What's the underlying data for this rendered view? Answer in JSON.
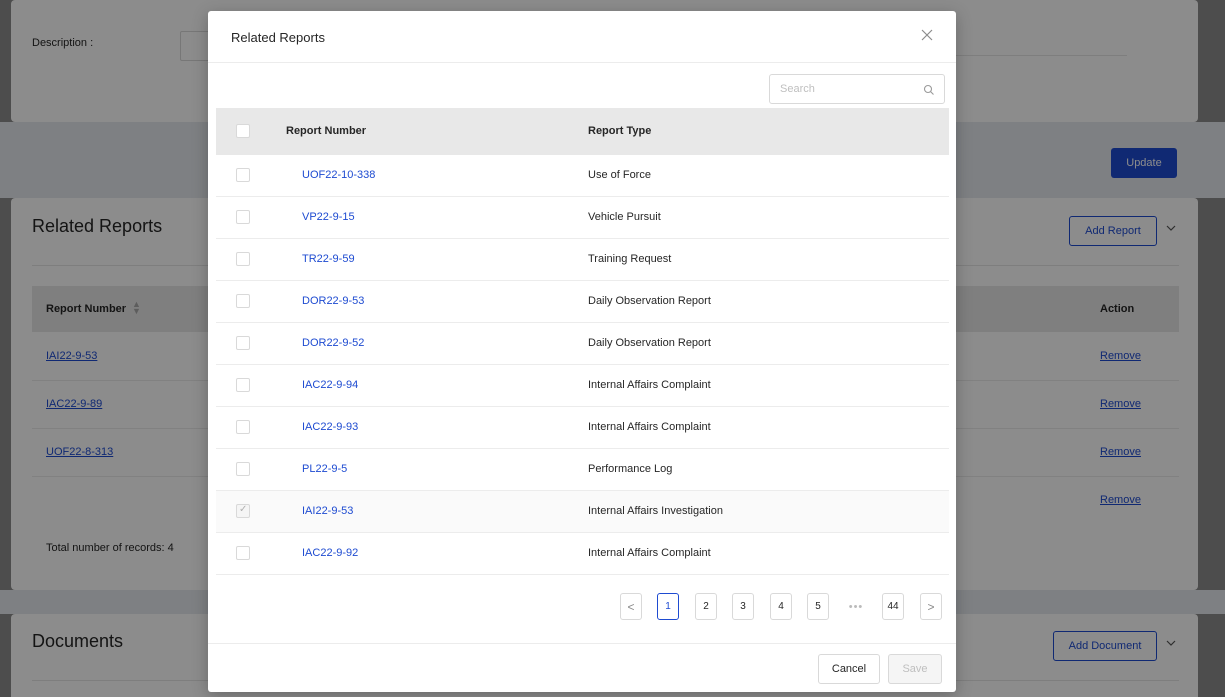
{
  "background": {
    "description_label": "Description :",
    "update_label": "Update",
    "related": {
      "title": "Related Reports",
      "add_label": "Add Report",
      "col_report_number": "Report Number",
      "col_action": "Action",
      "rows": [
        {
          "number": "IAI22-9-53",
          "action": "Remove"
        },
        {
          "number": "IAC22-9-89",
          "action": "Remove"
        },
        {
          "number": "UOF22-8-313",
          "action": "Remove"
        },
        {
          "number": "",
          "action": "Remove"
        }
      ],
      "total": "Total number of records: 4"
    },
    "documents": {
      "title": "Documents",
      "add_label": "Add Document"
    }
  },
  "modal": {
    "title": "Related Reports",
    "close_glyph": "✕",
    "search_placeholder": "Search",
    "columns": {
      "number": "Report Number",
      "type": "Report Type"
    },
    "rows": [
      {
        "number": "UOF22-10-338",
        "type": "Use of Force",
        "checked": false
      },
      {
        "number": "VP22-9-15",
        "type": "Vehicle Pursuit",
        "checked": false
      },
      {
        "number": "TR22-9-59",
        "type": "Training Request",
        "checked": false
      },
      {
        "number": "DOR22-9-53",
        "type": "Daily Observation Report",
        "checked": false
      },
      {
        "number": "DOR22-9-52",
        "type": "Daily Observation Report",
        "checked": false
      },
      {
        "number": "IAC22-9-94",
        "type": "Internal Affairs Complaint",
        "checked": false
      },
      {
        "number": "IAC22-9-93",
        "type": "Internal Affairs Complaint",
        "checked": false
      },
      {
        "number": "PL22-9-5",
        "type": "Performance Log",
        "checked": false
      },
      {
        "number": "IAI22-9-53",
        "type": "Internal Affairs Investigation",
        "checked": true
      },
      {
        "number": "IAC22-9-92",
        "type": "Internal Affairs Complaint",
        "checked": false
      }
    ],
    "pagination": {
      "prev": "<",
      "pages": [
        "1",
        "2",
        "3",
        "4",
        "5"
      ],
      "dots": "•••",
      "last": "44",
      "next": ">",
      "current": "1"
    },
    "cancel_label": "Cancel",
    "save_label": "Save"
  },
  "colors": {
    "accent": "#1e4bd1",
    "overlay": "rgba(0,0,0,0.45)"
  }
}
